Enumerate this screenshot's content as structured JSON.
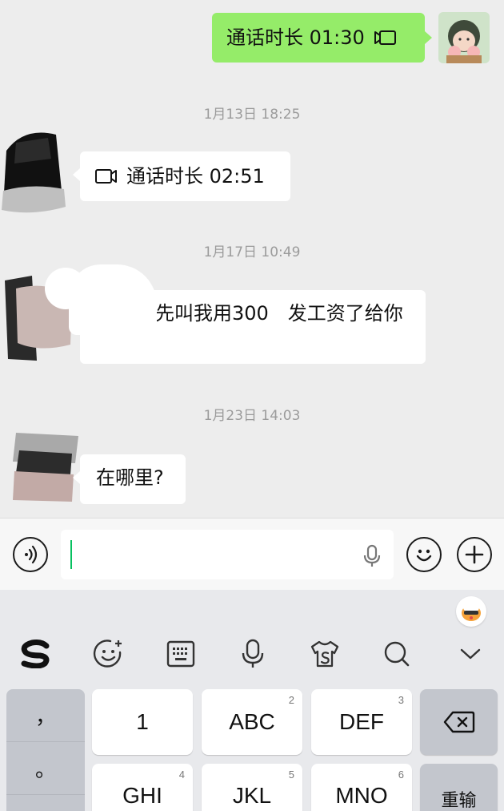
{
  "messages": [
    {
      "side": "right",
      "text": "通话时长 01:30",
      "icon": "video-call-icon"
    },
    {
      "timestamp": "1月13日 18:25"
    },
    {
      "side": "left",
      "text": "通话时长 02:51",
      "icon": "video-call-icon"
    },
    {
      "timestamp": "1月17日 10:49"
    },
    {
      "side": "left",
      "text": "先叫我用300　发工资了给你"
    },
    {
      "timestamp": "1月23日 14:03"
    },
    {
      "side": "left",
      "text": "在哪里?"
    }
  ],
  "input": {
    "value": "",
    "icons": [
      "voice-input-icon",
      "microphone-icon",
      "emoji-icon",
      "add-icon"
    ]
  },
  "keyboard": {
    "toolbar_icons": [
      "sogou-logo-icon",
      "emoji-icon",
      "keyboard-icon",
      "voice-icon",
      "skin-icon",
      "search-icon",
      "collapse-icon"
    ],
    "side_keys": [
      "，",
      "。",
      "?"
    ],
    "keys": [
      {
        "label": "1",
        "num": ""
      },
      {
        "label": "ABC",
        "num": "2"
      },
      {
        "label": "DEF",
        "num": "3"
      },
      {
        "label": "GHI",
        "num": "4"
      },
      {
        "label": "JKL",
        "num": "5"
      },
      {
        "label": "MNO",
        "num": "6"
      }
    ],
    "action_keys": {
      "backspace_icon": "backspace-icon",
      "reinput": "重输"
    }
  },
  "colors": {
    "my_bubble": "#95ec69",
    "their_bubble": "#ffffff",
    "background": "#ededed",
    "caret": "#07c160"
  }
}
